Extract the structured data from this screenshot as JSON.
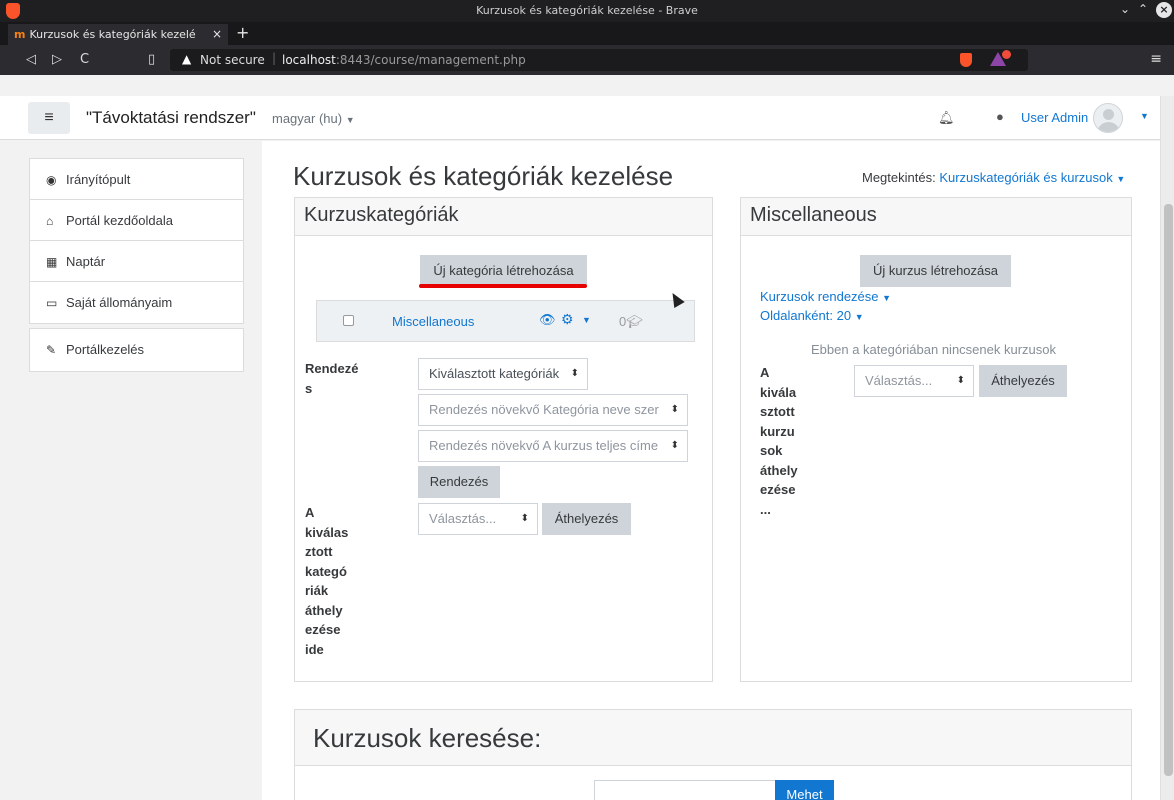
{
  "window": {
    "title": "Kurzusok és kategóriák kezelése - Brave"
  },
  "tab": {
    "favicon": "m",
    "label": "Kurzusok és kategóriák kezelé",
    "close": "×",
    "new": "+"
  },
  "address": {
    "warning_icon": "▲",
    "not_secure": "Not secure",
    "url_host": "localhost",
    "url_rest": ":8443/course/management.php"
  },
  "navbar": {
    "site_name": "\"Távoktatási rendszer\"",
    "language": "magyar (hu)",
    "user": "User Admin"
  },
  "sidebar": {
    "items": [
      {
        "label": "Irányítópult",
        "icon": "dashboard-icon",
        "glyph": "◉"
      },
      {
        "label": "Portál kezdőoldala",
        "icon": "home-icon",
        "glyph": "⌂"
      },
      {
        "label": "Naptár",
        "icon": "calendar-icon",
        "glyph": "▦"
      },
      {
        "label": "Saját állományaim",
        "icon": "file-icon",
        "glyph": "▭"
      }
    ],
    "admin": {
      "label": "Portálkezelés",
      "icon": "wrench-icon",
      "glyph": "✎"
    }
  },
  "page": {
    "title": "Kurzusok és kategóriák kezelése",
    "view_label": "Megtekintés:",
    "view_value": "Kurzuskategóriák és kurzusok"
  },
  "categories": {
    "header": "Kurzuskategóriák",
    "create_button": "Új kategória létrehozása",
    "row": {
      "name": "Miscellaneous",
      "count": "0"
    },
    "sort_label": "Rendezé s",
    "sort_select": "Kiválasztott kategóriák",
    "sort_cat_select": "Rendezés növekvő Kategória neve szer",
    "sort_course_select": "Rendezés növekvő A kurzus teljes címe",
    "sort_button": "Rendezés",
    "move_label": "A kiválas ztott kategó riák áthely ezése ide",
    "move_select": "Választás...",
    "move_button": "Áthelyezés"
  },
  "courses": {
    "header": "Miscellaneous",
    "create_button": "Új kurzus létrehozása",
    "sort_link": "Kurzusok rendezése",
    "per_page_link": "Oldalanként: 20",
    "empty": "Ebben a kategóriában nincsenek kurzusok",
    "move_label": "A kivála sztott kurzu sok áthely ezése ...",
    "move_select": "Választás...",
    "move_button": "Áthelyezés"
  },
  "search": {
    "header": "Kurzusok keresése:",
    "button": "Mehet"
  }
}
